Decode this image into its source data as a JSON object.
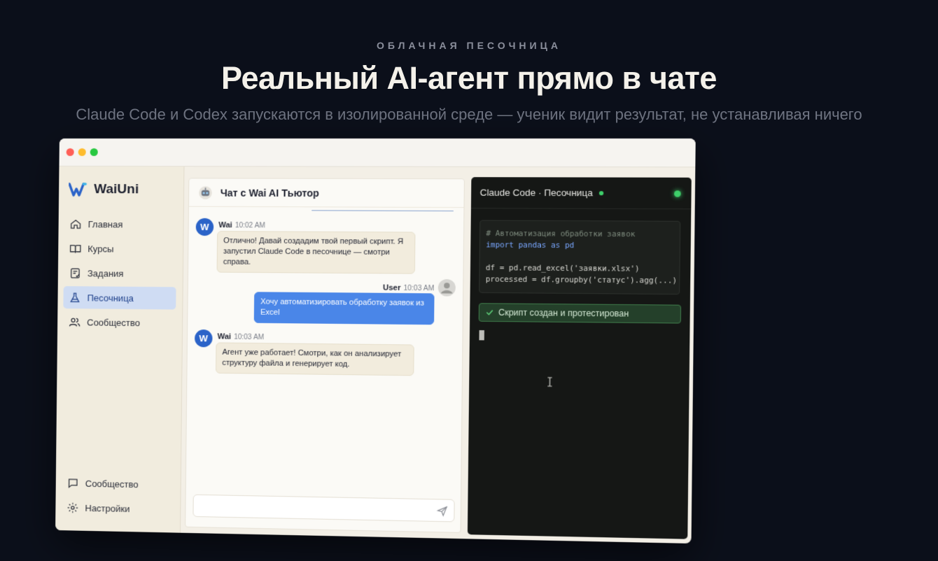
{
  "hero": {
    "eyebrow": "ОБЛАЧНАЯ ПЕСОЧНИЦА",
    "title": "Реальный AI-агент прямо в чате",
    "subtitle": "Claude Code и Codex запускаются в изолированной среде — ученик видит результат, не устанавливая ничего"
  },
  "app": {
    "brand": "WaiUni",
    "nav": [
      {
        "label": "Главная",
        "icon": "home-icon",
        "active": false
      },
      {
        "label": "Курсы",
        "icon": "book-icon",
        "active": false
      },
      {
        "label": "Задания",
        "icon": "tasks-icon",
        "active": false
      },
      {
        "label": "Песочница",
        "icon": "flask-icon",
        "active": true
      },
      {
        "label": "Сообщество",
        "icon": "users-icon",
        "active": false
      }
    ],
    "nav_bottom": [
      {
        "label": "Сообщество",
        "icon": "chat-bubble-icon"
      },
      {
        "label": "Настройки",
        "icon": "gear-icon"
      }
    ]
  },
  "chat": {
    "title": "Чат с Wai AI Тьютор",
    "messages": [
      {
        "author": "Wai",
        "time": "10:02 AM",
        "text": "Отлично! Давай создадим твой первый скрипт. Я запустил Claude Code в песочнице — смотри справа."
      },
      {
        "author": "User",
        "time": "10:03 AM",
        "text": "Хочу автоматизировать обработку заявок из Excel"
      },
      {
        "author": "Wai",
        "time": "10:03 AM",
        "text": "Агент уже работает! Смотри, как он анализирует структуру файла и генерирует код."
      }
    ],
    "avatar_letter": "W",
    "input_placeholder": ""
  },
  "terminal": {
    "title": "Claude Code · Песочница",
    "code_lines": [
      "# Автоматизация обработки заявок",
      "import pandas as pd",
      "",
      "df = pd.read_excel('заявки.xlsx')",
      "processed = df.groupby('статус').agg(...)"
    ],
    "success_text": "Скрипт создан и протестирован"
  },
  "colors": {
    "background": "#0b0f1a",
    "accent_blue": "#4a86e8",
    "status_green": "#3ecf6a"
  }
}
